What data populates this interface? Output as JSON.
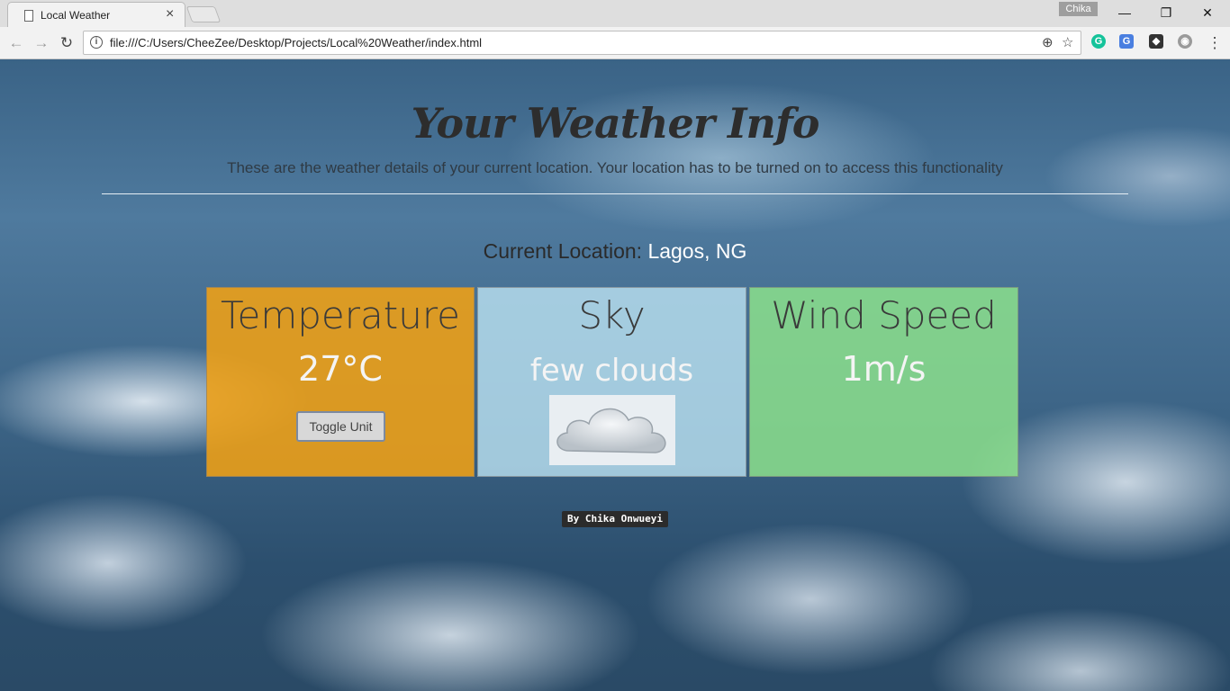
{
  "browser": {
    "tab_title": "Local Weather",
    "tab_close": "×",
    "profile_name": "Chika",
    "window_controls": {
      "minimize": "—",
      "restore": "❐",
      "close": "✕"
    },
    "nav": {
      "back": "←",
      "forward": "→",
      "reload": "↻"
    },
    "url": "file:///C:/Users/CheeZee/Desktop/Projects/Local%20Weather/index.html",
    "info_icon": "i",
    "location_icon": "⊕",
    "star_icon": "☆",
    "menu_icon": "⋮",
    "extensions": [
      {
        "name": "grammarly-extension-icon",
        "glyph": "G",
        "color": "#15c39a"
      },
      {
        "name": "translate-extension-icon",
        "glyph": "G",
        "color": "#4a7fe0"
      },
      {
        "name": "shield-extension-icon",
        "glyph": "◆",
        "color": "#333333"
      },
      {
        "name": "puzzle-extension-icon",
        "glyph": "◉",
        "color": "#9a9a9a"
      }
    ]
  },
  "page": {
    "title": "Your Weather Info",
    "subtitle": "These are the weather details of your current location. Your location has to be turned on to access this functionality",
    "location_label": "Current Location:",
    "location_value": "Lagos, NG",
    "cards": {
      "temperature": {
        "title": "Temperature",
        "value": "27°C",
        "button": "Toggle Unit",
        "color": "#f0a014"
      },
      "sky": {
        "title": "Sky",
        "value": "few clouds",
        "icon": "cloud-icon",
        "color": "#b9e1f0"
      },
      "wind": {
        "title": "Wind Speed",
        "value": "1m/s",
        "color": "#8ce18c"
      }
    },
    "credit": "By Chika Onwueyi"
  }
}
